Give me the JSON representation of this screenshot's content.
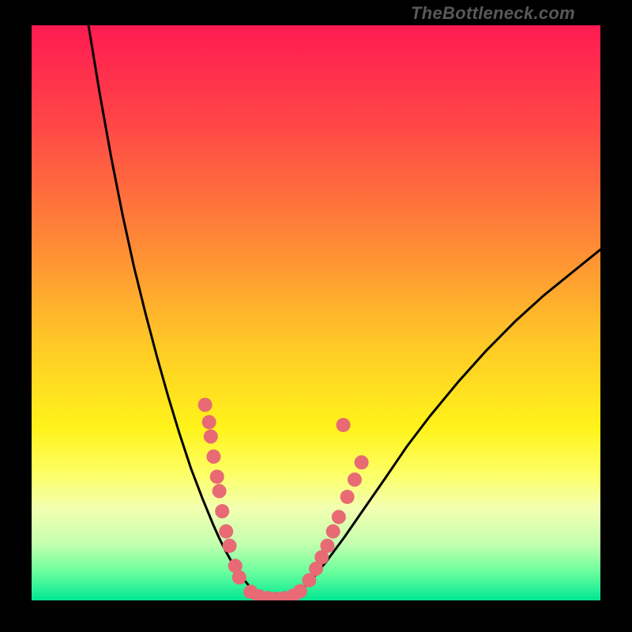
{
  "watermark": "TheBottleneck.com",
  "colors": {
    "frame": "#000000",
    "curve": "#000000",
    "dot": "#e76a74",
    "gradient_stops": [
      {
        "pct": 0,
        "c": "#ff1a52"
      },
      {
        "pct": 18,
        "c": "#ff4946"
      },
      {
        "pct": 38,
        "c": "#ff8a36"
      },
      {
        "pct": 55,
        "c": "#ffc727"
      },
      {
        "pct": 70,
        "c": "#fff31a"
      },
      {
        "pct": 78,
        "c": "#fdff66"
      },
      {
        "pct": 84,
        "c": "#f2ffb0"
      },
      {
        "pct": 90,
        "c": "#c6ffb0"
      },
      {
        "pct": 95,
        "c": "#6cff9e"
      },
      {
        "pct": 100,
        "c": "#00e792"
      }
    ]
  },
  "chart_data": {
    "type": "line",
    "title": "",
    "xlabel": "",
    "ylabel": "",
    "xlim": [
      0,
      100
    ],
    "ylim": [
      0,
      100
    ],
    "curve_left": {
      "x": [
        10,
        12,
        14,
        16,
        18,
        20,
        22,
        24,
        26,
        28,
        30,
        32,
        33,
        34,
        35,
        36,
        37,
        38,
        39,
        40
      ],
      "y": [
        100,
        88,
        77,
        67,
        58,
        50,
        42.5,
        35.5,
        29,
        23,
        17.8,
        13,
        10.8,
        8.8,
        7,
        5.4,
        4,
        2.8,
        1.6,
        0.8
      ]
    },
    "curve_floor": {
      "x": [
        40,
        41,
        42,
        43,
        44,
        45,
        46
      ],
      "y": [
        0.8,
        0.4,
        0.2,
        0.1,
        0.2,
        0.4,
        0.8
      ]
    },
    "curve_right": {
      "x": [
        46,
        48,
        50,
        52,
        55,
        58,
        62,
        66,
        70,
        75,
        80,
        85,
        90,
        95,
        100
      ],
      "y": [
        0.8,
        2.4,
        4.5,
        7,
        11,
        15.3,
        21,
        26.8,
        32,
        38,
        43.5,
        48.5,
        53,
        57,
        61
      ]
    },
    "dots": [
      {
        "x": 30.5,
        "y": 34
      },
      {
        "x": 31.2,
        "y": 31
      },
      {
        "x": 31.5,
        "y": 28.5
      },
      {
        "x": 32.0,
        "y": 25
      },
      {
        "x": 32.6,
        "y": 21.5
      },
      {
        "x": 33.0,
        "y": 19
      },
      {
        "x": 33.5,
        "y": 15.5
      },
      {
        "x": 34.2,
        "y": 12
      },
      {
        "x": 34.8,
        "y": 9.5
      },
      {
        "x": 35.8,
        "y": 6
      },
      {
        "x": 36.5,
        "y": 4
      },
      {
        "x": 38.5,
        "y": 1.5
      },
      {
        "x": 40.0,
        "y": 0.7
      },
      {
        "x": 41.5,
        "y": 0.4
      },
      {
        "x": 43.0,
        "y": 0.3
      },
      {
        "x": 44.5,
        "y": 0.4
      },
      {
        "x": 46.0,
        "y": 0.8
      },
      {
        "x": 47.2,
        "y": 1.6
      },
      {
        "x": 48.8,
        "y": 3.5
      },
      {
        "x": 50.0,
        "y": 5.5
      },
      {
        "x": 51.0,
        "y": 7.5
      },
      {
        "x": 52.0,
        "y": 9.5
      },
      {
        "x": 53.0,
        "y": 12
      },
      {
        "x": 54.0,
        "y": 14.5
      },
      {
        "x": 55.5,
        "y": 18
      },
      {
        "x": 56.8,
        "y": 21
      },
      {
        "x": 58.0,
        "y": 24
      },
      {
        "x": 54.8,
        "y": 30.5
      }
    ]
  }
}
